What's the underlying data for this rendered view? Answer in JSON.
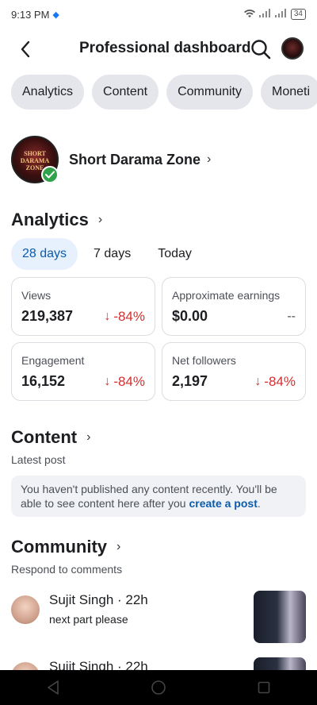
{
  "status": {
    "time": "9:13 PM",
    "battery": "34"
  },
  "header": {
    "title": "Professional dashboard"
  },
  "chips": [
    "Analytics",
    "Content",
    "Community",
    "Moneti"
  ],
  "profile": {
    "name": "Short Darama Zone",
    "avatar_text": "SHORT DARAMA ZONE"
  },
  "analytics": {
    "title": "Analytics",
    "tabs": [
      "28 days",
      "7 days",
      "Today"
    ],
    "active_tab": "28 days",
    "cards": {
      "views": {
        "label": "Views",
        "value": "219,387",
        "delta": "-84%"
      },
      "earnings": {
        "label": "Approximate earnings",
        "value": "$0.00",
        "delta": "--"
      },
      "engagement": {
        "label": "Engagement",
        "value": "16,152",
        "delta": "-84%"
      },
      "followers": {
        "label": "Net followers",
        "value": "2,197",
        "delta": "-84%"
      }
    }
  },
  "content": {
    "title": "Content",
    "subtitle": "Latest post",
    "notice_text": "You haven't published any content recently. You'll be able to see content here after you ",
    "notice_link": "create a post",
    "notice_end": "."
  },
  "community": {
    "title": "Community",
    "subtitle": "Respond to comments",
    "comments": [
      {
        "name": "Sujit Singh · 22h",
        "text": "next part please"
      },
      {
        "name": "Sujit Singh · 22h",
        "text": ""
      }
    ]
  },
  "colors": {
    "accent": "#0b5cad",
    "negative": "#d32f2f",
    "verified": "#31a24c"
  }
}
